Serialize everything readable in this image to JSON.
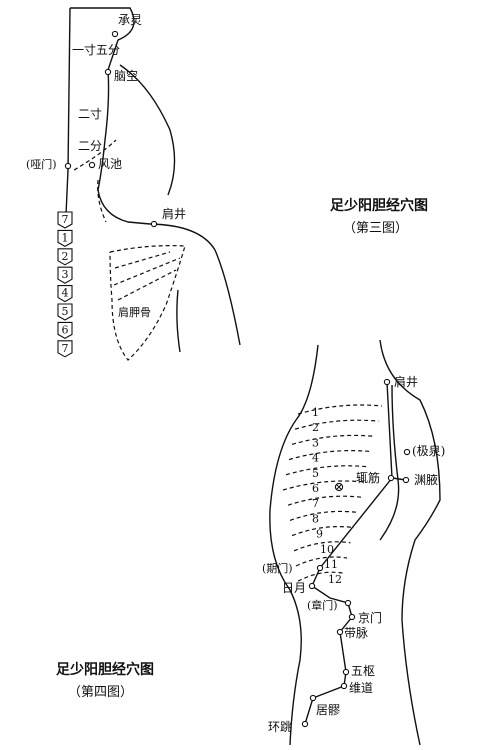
{
  "figure3": {
    "title": "足少阳胆经穴图",
    "subtitle": "（第三图）",
    "points": {
      "chengling": "承灵",
      "naokong": "脑空",
      "fengchi": "风池",
      "yamen": "(哑门)",
      "jianjing": "肩井"
    },
    "measures": {
      "upper": "一寸五分",
      "lower_top": "二寸",
      "lower_bottom": "二分"
    },
    "bone_label": "肩胛骨",
    "vertebrae": [
      "7",
      "1",
      "2",
      "3",
      "4",
      "5",
      "6",
      "7"
    ]
  },
  "figure4": {
    "title": "足少阳胆经穴图",
    "subtitle": "（第四图）",
    "points": {
      "jianjing": "肩井",
      "jiquan": "(极泉)",
      "zhejin": "辄筋",
      "yuanye": "渊腋",
      "qimen": "(期门)",
      "riyue": "日月",
      "zhangmen": "(章门)",
      "jingmen": "京门",
      "daimai": "带脉",
      "wushu": "五枢",
      "weidao": "维道",
      "juliao": "居髎",
      "huantiao": "环跳"
    },
    "ribs": [
      "1",
      "2",
      "3",
      "4",
      "5",
      "6",
      "7",
      "8",
      "9",
      "10",
      "11",
      "12"
    ]
  }
}
